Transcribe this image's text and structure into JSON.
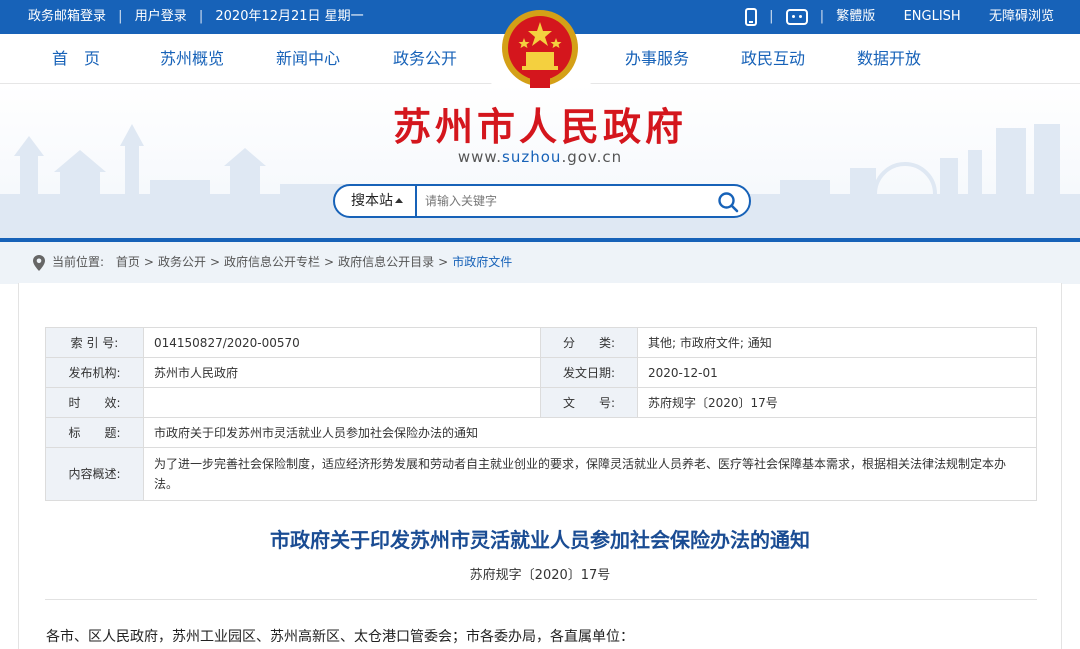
{
  "topbar": {
    "links": [
      "政务邮箱登录",
      "用户登录"
    ],
    "date": "2020年12月21日 星期一",
    "right_links": [
      "繁體版",
      "ENGLISH",
      "无障碍浏览"
    ],
    "icons": [
      "mobile-phone-icon",
      "robot-assistant-icon"
    ]
  },
  "nav": {
    "items": [
      "首　页",
      "苏州概览",
      "新闻中心",
      "政务公开",
      "办事服务",
      "政民互动",
      "数据开放"
    ]
  },
  "header": {
    "title": "苏州市人民政府",
    "url_prefix": "www.",
    "url_highlight": "suzhou",
    "url_suffix": ".gov.cn"
  },
  "search": {
    "scope_label": "搜本站",
    "placeholder": "请输入关键字"
  },
  "breadcrumb": {
    "label": "当前位置:",
    "items": [
      "首页",
      "政务公开",
      "政府信息公开专栏",
      "政府信息公开目录",
      "市政府文件"
    ]
  },
  "meta": {
    "index_no_label": "索 引 号:",
    "index_no": "014150827/2020-00570",
    "category_label": "分　　类:",
    "category": "其他;  市政府文件;  通知",
    "publisher_label": "发布机构:",
    "publisher": "苏州市人民政府",
    "date_label": "发文日期:",
    "date": "2020-12-01",
    "validity_label": "时　　效:",
    "validity": "",
    "doc_no_label": "文　　号:",
    "doc_no": "苏府规字〔2020〕17号",
    "title_label": "标　　题:",
    "title": "市政府关于印发苏州市灵活就业人员参加社会保险办法的通知",
    "summary_label": "内容概述:",
    "summary": "为了进一步完善社会保险制度，适应经济形势发展和劳动者自主就业创业的要求，保障灵活就业人员养老、医疗等社会保障基本需求，根据相关法律法规制定本办法。"
  },
  "document": {
    "title": "市政府关于印发苏州市灵活就业人员参加社会保险办法的通知",
    "number": "苏府规字〔2020〕17号",
    "salutation": "各市、区人民政府，苏州工业园区、苏州高新区、太仓港口管委会；市各委办局，各直属单位："
  },
  "colors": {
    "primary_blue": "#1762b8",
    "title_red": "#d4161d",
    "doc_title_blue": "#1a4c93"
  }
}
